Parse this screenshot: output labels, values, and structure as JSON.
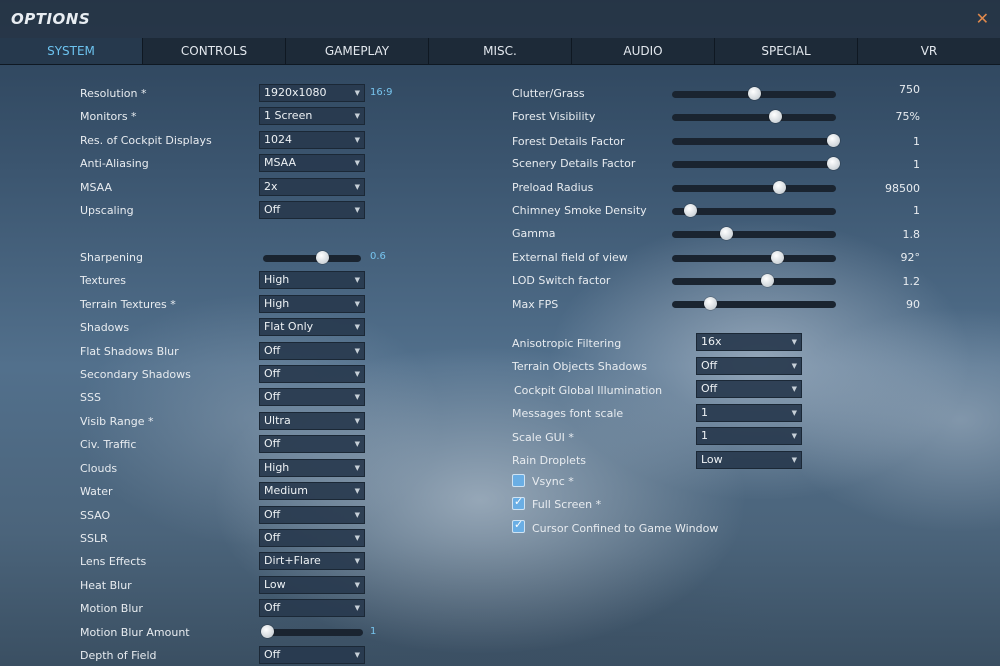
{
  "window": {
    "title": "OPTIONS",
    "close_icon": "close-icon"
  },
  "tabs": [
    "SYSTEM",
    "CONTROLS",
    "GAMEPLAY",
    "MISC.",
    "AUDIO",
    "SPECIAL",
    "VR"
  ],
  "active_tab": "SYSTEM",
  "accent_color": "#6cc2ee",
  "left": {
    "resolution": {
      "label": "Resolution *",
      "value": "1920x1080",
      "note": "16:9"
    },
    "monitors": {
      "label": "Monitors *",
      "value": "1 Screen"
    },
    "cockpit_displays": {
      "label": "Res. of Cockpit Displays",
      "value": "1024"
    },
    "anti_aliasing": {
      "label": "Anti-Aliasing",
      "value": "MSAA"
    },
    "msaa": {
      "label": "MSAA",
      "value": "2x"
    },
    "upscaling": {
      "label": "Upscaling",
      "value": "Off"
    },
    "sharpening": {
      "label": "Sharpening",
      "value": "0.6",
      "fraction": 0.6
    },
    "textures": {
      "label": "Textures",
      "value": "High"
    },
    "terrain_textures": {
      "label": "Terrain Textures *",
      "value": "High"
    },
    "shadows": {
      "label": "Shadows",
      "value": "Flat Only"
    },
    "flat_shadows_blur": {
      "label": "Flat Shadows Blur",
      "value": "Off"
    },
    "secondary_shadows": {
      "label": "Secondary Shadows",
      "value": "Off"
    },
    "sss": {
      "label": "SSS",
      "value": "Off"
    },
    "visib_range": {
      "label": "Visib Range *",
      "value": "Ultra"
    },
    "civ_traffic": {
      "label": "Civ. Traffic",
      "value": "Off"
    },
    "clouds": {
      "label": "Clouds",
      "value": "High"
    },
    "water": {
      "label": "Water",
      "value": "Medium"
    },
    "ssao": {
      "label": "SSAO",
      "value": "Off"
    },
    "sslr": {
      "label": "SSLR",
      "value": "Off"
    },
    "lens_effects": {
      "label": "Lens Effects",
      "value": "Dirt+Flare"
    },
    "heat_blur": {
      "label": "Heat Blur",
      "value": "Low"
    },
    "motion_blur": {
      "label": "Motion Blur",
      "value": "Off"
    },
    "motion_blur_amount": {
      "label": "Motion Blur Amount",
      "value": "1",
      "fraction": 0.0
    },
    "depth_of_field": {
      "label": "Depth of Field",
      "value": "Off"
    }
  },
  "right": {
    "clutter_grass": {
      "label": "Clutter/Grass",
      "value": "750",
      "fraction": 0.5
    },
    "forest_visibility": {
      "label": "Forest Visibility",
      "value": "75%",
      "fraction": 0.63
    },
    "forest_details": {
      "label": "Forest Details Factor",
      "value": "1",
      "fraction": 0.98
    },
    "scenery_details": {
      "label": "Scenery Details Factor",
      "value": "1",
      "fraction": 0.98
    },
    "preload_radius": {
      "label": "Preload Radius",
      "value": "98500",
      "fraction": 0.65
    },
    "chimney_smoke": {
      "label": "Chimney Smoke Density",
      "value": "1",
      "fraction": 0.11
    },
    "gamma": {
      "label": "Gamma",
      "value": "1.8",
      "fraction": 0.33
    },
    "fov": {
      "label": "External field of view",
      "value": "92°",
      "fraction": 0.64
    },
    "lod_switch": {
      "label": "LOD Switch factor",
      "value": "1.2",
      "fraction": 0.58
    },
    "max_fps": {
      "label": "Max FPS",
      "value": "90",
      "fraction": 0.23
    },
    "anisotropic": {
      "label": "Anisotropic Filtering",
      "value": "16x"
    },
    "terrain_objects_shadows": {
      "label": "Terrain Objects Shadows",
      "value": "Off"
    },
    "cockpit_gi": {
      "label": "Cockpit Global Illumination",
      "value": "Off"
    },
    "messages_font": {
      "label": "Messages font scale",
      "value": "1"
    },
    "scale_gui": {
      "label": "Scale GUI *",
      "value": "1"
    },
    "rain_droplets": {
      "label": "Rain Droplets",
      "value": "Low"
    },
    "vsync": {
      "label": "Vsync *",
      "checked": false
    },
    "full_screen": {
      "label": "Full Screen *",
      "checked": true
    },
    "cursor_confined": {
      "label": "Cursor Confined to Game Window",
      "checked": true
    }
  }
}
